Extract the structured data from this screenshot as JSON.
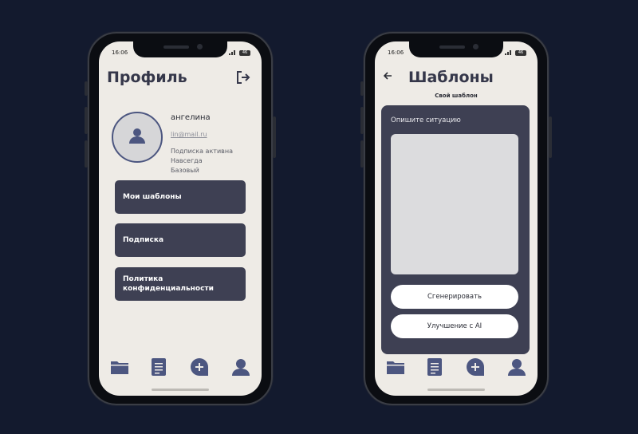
{
  "left_phone": {
    "status": {
      "time": "16:06",
      "battery": "46"
    },
    "title": "Профиль",
    "user": {
      "name": "ангелина",
      "email": "lin@mail.ru",
      "subscription_status": "Подписка активна",
      "subscription_term": "Навсегда",
      "subscription_plan": "Базовый"
    },
    "menu": [
      {
        "label": "Мои шаблоны"
      },
      {
        "label": "Подписка"
      },
      {
        "label_line1": "Политика",
        "label_line2": "конфиденциальности"
      }
    ],
    "nav_icons": [
      "folder-icon",
      "document-icon",
      "add-chat-icon",
      "profile-icon"
    ]
  },
  "right_phone": {
    "status": {
      "time": "16:06",
      "battery": "46"
    },
    "title": "Шаблоны",
    "subtitle": "Свой шаблон",
    "card_label": "Опишите ситуацию",
    "generate_label": "Сгенерировать",
    "improve_label": "Улучшение с AI",
    "nav_icons": [
      "folder-icon",
      "document-icon",
      "add-chat-icon",
      "profile-icon"
    ]
  },
  "colors": {
    "background": "#131a2e",
    "screen": "#eeebe6",
    "button_dark": "#3e4053",
    "accent": "#4c5680"
  }
}
